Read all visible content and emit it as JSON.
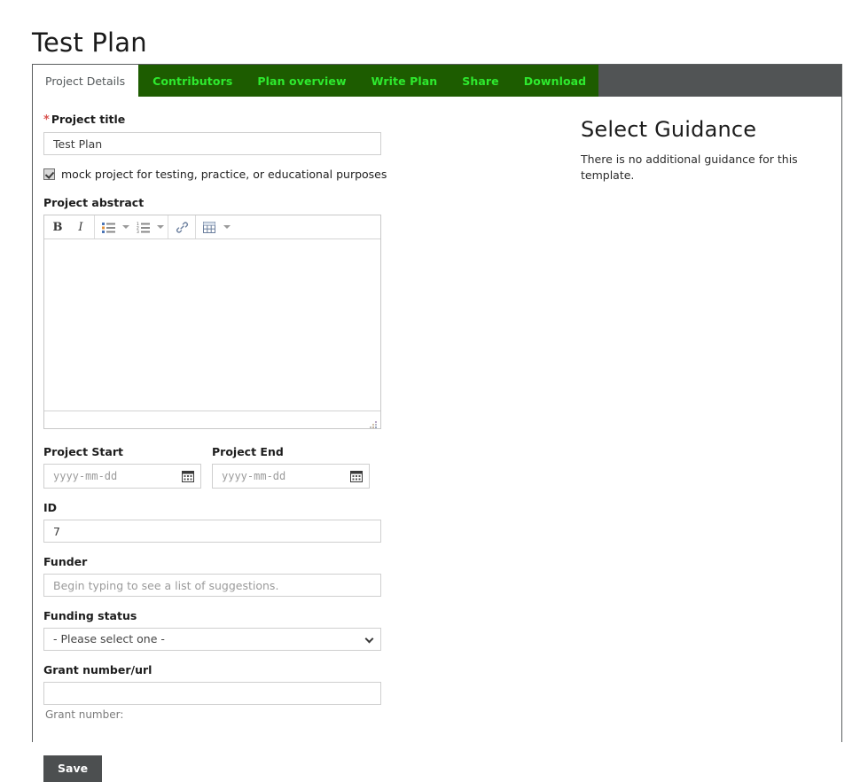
{
  "page": {
    "title": "Test Plan"
  },
  "tabs": [
    {
      "label": "Project Details",
      "active": true,
      "style": "active"
    },
    {
      "label": "Contributors",
      "active": false,
      "style": "green"
    },
    {
      "label": "Plan overview",
      "active": false,
      "style": "green"
    },
    {
      "label": "Write Plan",
      "active": false,
      "style": "green"
    },
    {
      "label": "Share",
      "active": false,
      "style": "green"
    },
    {
      "label": "Download",
      "active": false,
      "style": "green"
    }
  ],
  "form": {
    "project_title": {
      "label": "Project title",
      "required_marker": "*",
      "value": "Test Plan",
      "placeholder": ""
    },
    "mock_checkbox": {
      "label": "mock project for testing, practice, or educational purposes",
      "checked": true
    },
    "project_abstract": {
      "label": "Project abstract",
      "value": "",
      "toolbar": [
        {
          "name": "bold",
          "glyph": "B"
        },
        {
          "name": "italic",
          "glyph": "I"
        },
        {
          "name": "bullet-list",
          "glyph": ""
        },
        {
          "name": "bullet-list-options",
          "glyph": ""
        },
        {
          "name": "numbered-list",
          "glyph": ""
        },
        {
          "name": "numbered-list-options",
          "glyph": ""
        },
        {
          "name": "link",
          "glyph": ""
        },
        {
          "name": "table",
          "glyph": ""
        },
        {
          "name": "table-options",
          "glyph": ""
        }
      ]
    },
    "project_start": {
      "label": "Project Start",
      "value": "",
      "placeholder": "yyyy-mm-dd"
    },
    "project_end": {
      "label": "Project End",
      "value": "",
      "placeholder": "yyyy-mm-dd"
    },
    "id": {
      "label": "ID",
      "value": "7",
      "placeholder": ""
    },
    "funder": {
      "label": "Funder",
      "value": "",
      "placeholder": "Begin typing to see a list of suggestions."
    },
    "funding_status": {
      "label": "Funding status",
      "selected": "- Please select one -",
      "options": [
        "- Please select one -"
      ]
    },
    "grant_number": {
      "label": "Grant number/url",
      "value": "",
      "placeholder": "",
      "hint": "Grant number:"
    },
    "save_button": {
      "label": "Save"
    }
  },
  "guidance": {
    "title": "Select Guidance",
    "body": "There is no additional guidance for this template."
  },
  "colors": {
    "tabbar_bg": "#515455",
    "tab_green_bg": "#1d5c00",
    "tab_green_text": "#2eea2e",
    "save_bg": "#4c4f50",
    "required_marker": "#d9534f"
  }
}
